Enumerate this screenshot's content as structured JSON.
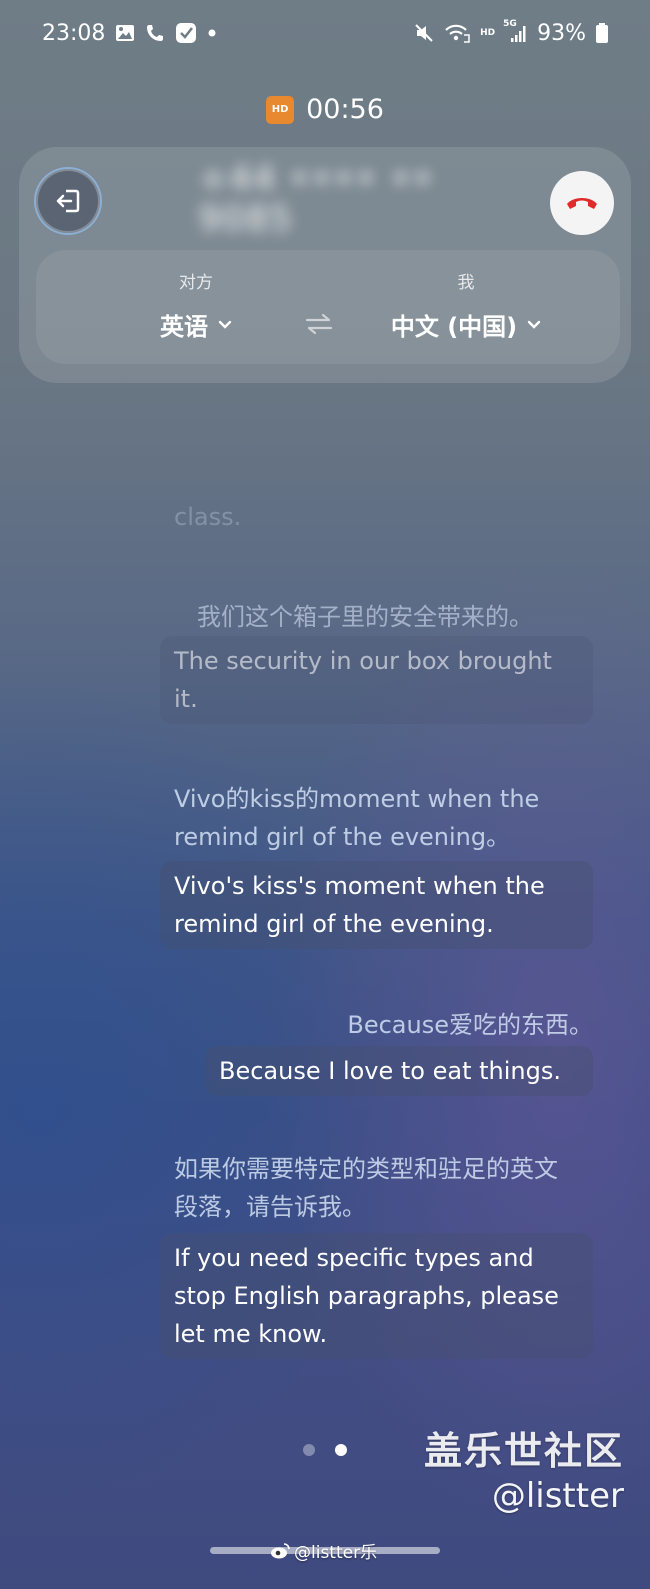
{
  "status_bar": {
    "time": "23:08",
    "hd_label": "HD",
    "net_label": "5G",
    "battery": "93%"
  },
  "call": {
    "hd_badge": "HD",
    "timer": "00:56",
    "caller_number": "+44 •••• •• 9085"
  },
  "languages": {
    "other_label": "对方",
    "other_language": "英语",
    "me_label": "我",
    "my_language": "中文 (中国)"
  },
  "transcript": [
    {
      "original": "class.",
      "translation": ""
    },
    {
      "original": "我们这个箱子里的安全带来的。",
      "translation": "The security in our box brought it."
    },
    {
      "original": "Vivo的kiss的moment when the remind girl of the evening。",
      "translation": "Vivo's kiss's moment when the remind girl of the evening."
    },
    {
      "original": "Because爱吃的东西。",
      "translation": "Because I love to eat things."
    },
    {
      "original": "如果你需要特定的类型和驻足的英文段落，请告诉我。",
      "translation": "If you need specific types and stop English paragraphs, please let me know."
    }
  ],
  "watermark": {
    "site": "盖乐世社区",
    "handle": "@listter",
    "weibo": "@listter乐"
  }
}
